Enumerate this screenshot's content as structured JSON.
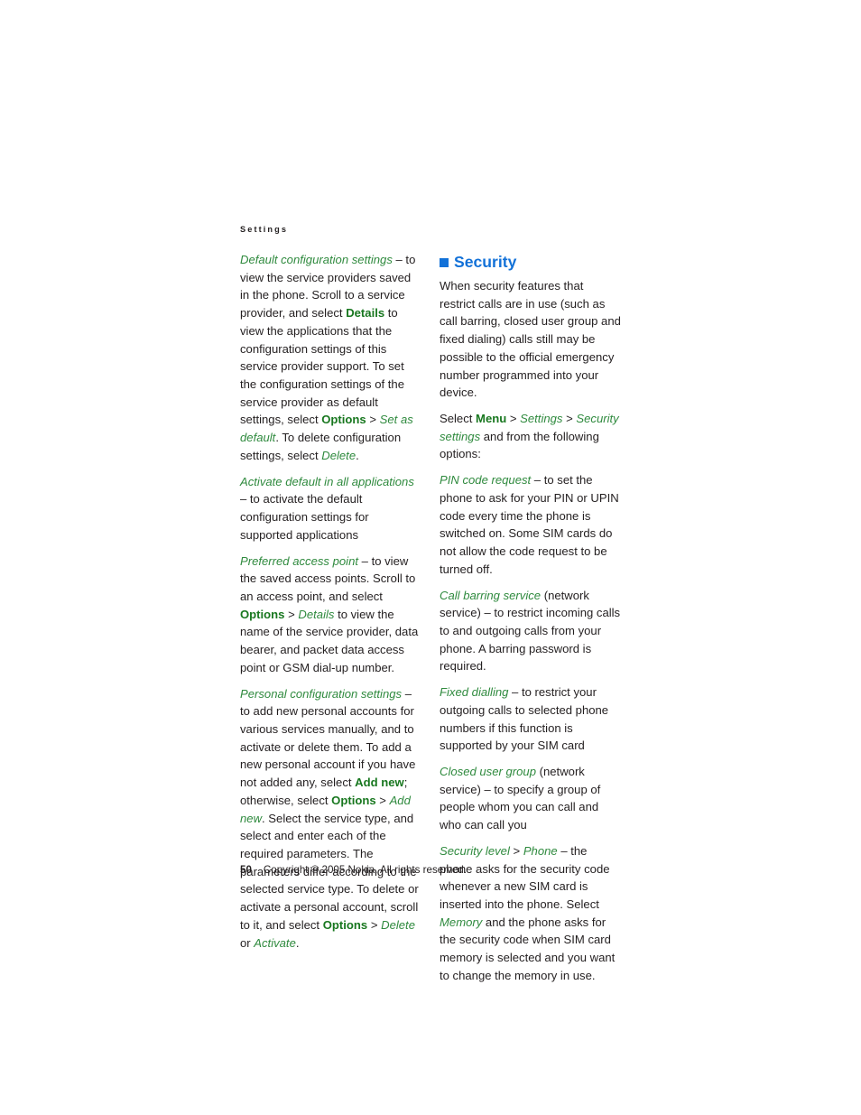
{
  "document": {
    "running_header": "Settings",
    "page_number": "50",
    "copyright": "Copyright © 2005 Nokia. All rights reserved."
  },
  "colors": {
    "ui_term_green": "#2f8a3e",
    "command_green": "#18771f",
    "heading_blue": "#1271d8",
    "body_black": "#231f20"
  },
  "left_column": {
    "paragraphs": [
      {
        "id": "default-configuration-settings",
        "runs": [
          {
            "style": "ui",
            "text": "Default configuration settings"
          },
          {
            "style": "plain",
            "text": " – to view the service providers saved in the phone. Scroll to a service provider, and select "
          },
          {
            "style": "key",
            "text": "Details"
          },
          {
            "style": "plain",
            "text": " to view the applications that the configuration settings of this service provider support. To set the configuration settings of the service provider as default settings, select "
          },
          {
            "style": "key",
            "text": "Options"
          },
          {
            "style": "gt",
            "text": " > "
          },
          {
            "style": "ui",
            "text": "Set as default"
          },
          {
            "style": "plain",
            "text": ". To delete configuration settings, select "
          },
          {
            "style": "ui",
            "text": "Delete"
          },
          {
            "style": "plain",
            "text": "."
          }
        ]
      },
      {
        "id": "activate-default-in-all-applications",
        "runs": [
          {
            "style": "ui",
            "text": "Activate default in all applications"
          },
          {
            "style": "plain",
            "text": " – to activate the default configuration settings for supported applications"
          }
        ]
      },
      {
        "id": "preferred-access-point",
        "runs": [
          {
            "style": "ui",
            "text": "Preferred access point"
          },
          {
            "style": "plain",
            "text": " – to view the saved access points. Scroll to an access point, and select "
          },
          {
            "style": "key",
            "text": "Options"
          },
          {
            "style": "gt",
            "text": " > "
          },
          {
            "style": "ui",
            "text": "Details"
          },
          {
            "style": "plain",
            "text": " to view the name of the service provider, data bearer, and packet data access point or GSM dial-up number."
          }
        ]
      },
      {
        "id": "personal-configuration-settings",
        "runs": [
          {
            "style": "ui",
            "text": "Personal configuration settings"
          },
          {
            "style": "plain",
            "text": " – to add new personal accounts for various services manually, and to activate or delete them. To add a new personal account if you have not added any, select "
          },
          {
            "style": "key",
            "text": "Add new"
          },
          {
            "style": "plain",
            "text": "; otherwise, select "
          },
          {
            "style": "key",
            "text": "Options"
          },
          {
            "style": "gt",
            "text": " > "
          },
          {
            "style": "ui",
            "text": "Add new"
          },
          {
            "style": "plain",
            "text": ". Select the service type, and select and enter each of the required parameters. The parameters differ according to the selected service type. To delete or activate a personal account, scroll to it, and select "
          },
          {
            "style": "key",
            "text": "Options"
          },
          {
            "style": "gt",
            "text": " > "
          },
          {
            "style": "ui",
            "text": "Delete"
          },
          {
            "style": "plain",
            "text": " or "
          },
          {
            "style": "ui",
            "text": "Activate"
          },
          {
            "style": "plain",
            "text": "."
          }
        ]
      }
    ]
  },
  "right_column": {
    "heading": "Security",
    "heading_bullet": "square-bullet-icon",
    "paragraphs": [
      {
        "id": "security-intro",
        "runs": [
          {
            "style": "plain",
            "text": "When security features that restrict calls are in use (such as call barring, closed user group and fixed dialing) calls still may be possible to the official emergency number programmed into your device."
          }
        ]
      },
      {
        "id": "security-menu-path",
        "runs": [
          {
            "style": "plain",
            "text": "Select "
          },
          {
            "style": "key",
            "text": "Menu"
          },
          {
            "style": "gt",
            "text": " > "
          },
          {
            "style": "ui",
            "text": "Settings"
          },
          {
            "style": "gt",
            "text": " > "
          },
          {
            "style": "ui",
            "text": "Security settings"
          },
          {
            "style": "plain",
            "text": " and from the following options:"
          }
        ]
      },
      {
        "id": "pin-code-request",
        "runs": [
          {
            "style": "ui",
            "text": "PIN code request"
          },
          {
            "style": "plain",
            "text": " – to set the phone to ask for your PIN or UPIN code every time the phone is switched on. Some SIM cards do not allow the code request to be turned off."
          }
        ]
      },
      {
        "id": "call-barring-service",
        "runs": [
          {
            "style": "ui",
            "text": "Call barring service"
          },
          {
            "style": "plain",
            "text": " (network service) – to restrict incoming calls to and outgoing calls from your phone. A barring password is required."
          }
        ]
      },
      {
        "id": "fixed-dialling",
        "runs": [
          {
            "style": "ui",
            "text": "Fixed dialling"
          },
          {
            "style": "plain",
            "text": " – to restrict your outgoing calls to selected phone numbers if this function is supported by your SIM card"
          }
        ]
      },
      {
        "id": "closed-user-group",
        "runs": [
          {
            "style": "ui",
            "text": "Closed user group"
          },
          {
            "style": "plain",
            "text": " (network service) – to specify a group of people whom you can call and who can call you"
          }
        ]
      },
      {
        "id": "security-level",
        "runs": [
          {
            "style": "ui",
            "text": "Security level"
          },
          {
            "style": "gt",
            "text": " > "
          },
          {
            "style": "ui",
            "text": "Phone"
          },
          {
            "style": "plain",
            "text": " – the phone asks for the security code whenever a new SIM card is inserted into the phone. Select "
          },
          {
            "style": "ui",
            "text": "Memory"
          },
          {
            "style": "plain",
            "text": " and the phone asks for the security code when SIM card memory is selected and you want to change the memory in use."
          }
        ]
      }
    ]
  }
}
